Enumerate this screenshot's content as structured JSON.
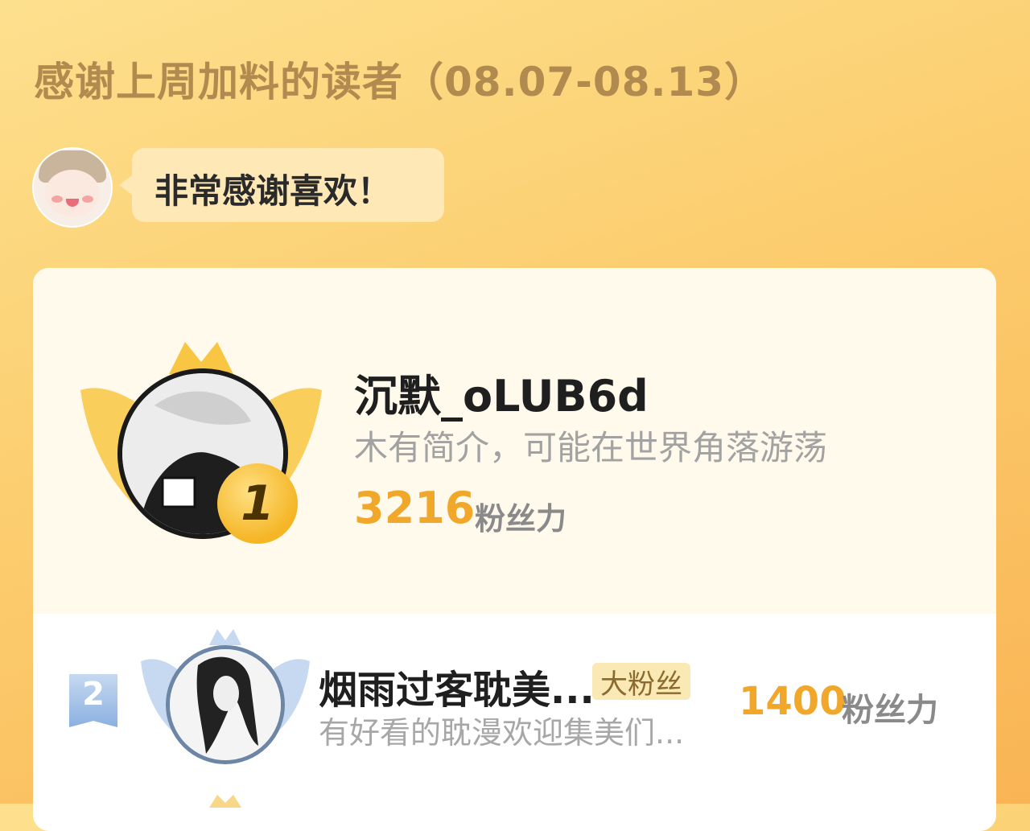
{
  "header": {
    "title": "感谢上周加料的读者（08.07-08.13）",
    "greeting": "非常感谢喜欢！"
  },
  "ranking": [
    {
      "rank": "1",
      "name": "沉默_oLUB6d",
      "bio": "木有简介，可能在世界角落游荡",
      "score": "3216",
      "unit": "粉丝力"
    },
    {
      "rank": "2",
      "name": "烟雨过客耽美...",
      "tag": "大粉丝",
      "bio": "有好看的耽漫欢迎集美们...",
      "score": "1400",
      "unit": "粉丝力"
    }
  ],
  "colors": {
    "accent": "#f0a72a",
    "title": "#b08a4f",
    "rank2_accent": "#8bb0e0"
  }
}
